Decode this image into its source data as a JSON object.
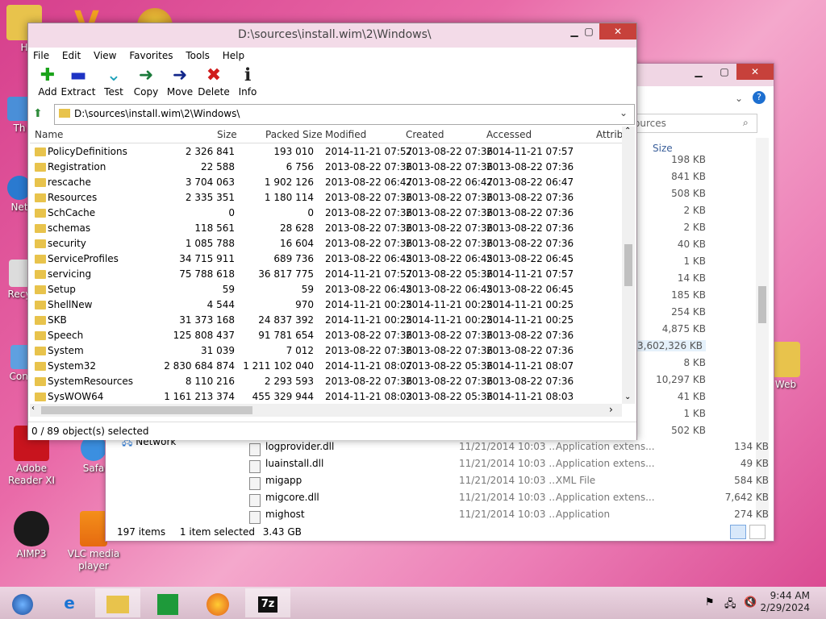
{
  "desktop": {
    "icons": [
      {
        "label": "H",
        "x": 0
      },
      {
        "label": "Th"
      },
      {
        "label": "Net"
      },
      {
        "label": "Recy"
      },
      {
        "label": "Contr"
      },
      {
        "label": "Adobe Reader XI"
      },
      {
        "label": "Safa"
      },
      {
        "label": "AIMP3"
      },
      {
        "label": "VLC media player"
      },
      {
        "label": "Web"
      }
    ]
  },
  "explorer": {
    "search_placeholder": "ources",
    "size_header": "Size",
    "sizes": [
      "198 KB",
      "841 KB",
      "508 KB",
      "2 KB",
      "2 KB",
      "40 KB",
      "1 KB",
      "14 KB",
      "185 KB",
      "254 KB",
      "4,875 KB",
      "3,602,326 KB",
      "8 KB",
      "10,297 KB",
      "41 KB",
      "1 KB",
      "502 KB"
    ],
    "nav_network": "Network",
    "files": [
      {
        "name": "logprovider.dll",
        "date": "11/21/2014 10:03 ...",
        "type": "Application extens...",
        "size": "134 KB"
      },
      {
        "name": "luainstall.dll",
        "date": "11/21/2014 10:03 ...",
        "type": "Application extens...",
        "size": "49 KB"
      },
      {
        "name": "migapp",
        "date": "11/21/2014 10:03 ...",
        "type": "XML File",
        "size": "584 KB"
      },
      {
        "name": "migcore.dll",
        "date": "11/21/2014 10:03 ...",
        "type": "Application extens...",
        "size": "7,642 KB"
      },
      {
        "name": "mighost",
        "date": "11/21/2014 10:03 ...",
        "type": "Application",
        "size": "274 KB"
      }
    ],
    "status_items": "197 items",
    "status_selected": "1 item selected",
    "status_size": "3.43 GB"
  },
  "sevenzip": {
    "title": "D:\\sources\\install.wim\\2\\Windows\\",
    "menu": [
      "File",
      "Edit",
      "View",
      "Favorites",
      "Tools",
      "Help"
    ],
    "toolbar": [
      {
        "label": "Add",
        "glyph": "✚",
        "color": "#1aa31a"
      },
      {
        "label": "Extract",
        "glyph": "▬",
        "color": "#1d33c4"
      },
      {
        "label": "Test",
        "glyph": "⌄",
        "color": "#1aa0b8"
      },
      {
        "label": "Copy",
        "glyph": "➜",
        "color": "#1a7a3a"
      },
      {
        "label": "Move",
        "glyph": "➜",
        "color": "#12268a"
      },
      {
        "label": "Delete",
        "glyph": "✖",
        "color": "#d01c1c"
      },
      {
        "label": "Info",
        "glyph": "ℹ",
        "color": "#222222"
      }
    ],
    "address": "D:\\sources\\install.wim\\2\\Windows\\",
    "columns": [
      "Name",
      "Size",
      "Packed Size",
      "Modified",
      "Created",
      "Accessed",
      "Attrib"
    ],
    "rows": [
      [
        "PolicyDefinitions",
        "2 326 841",
        "193 010",
        "2014-11-21 07:57",
        "2013-08-22 07:36",
        "2014-11-21 07:57"
      ],
      [
        "Registration",
        "22 588",
        "6 756",
        "2013-08-22 07:36",
        "2013-08-22 07:36",
        "2013-08-22 07:36"
      ],
      [
        "rescache",
        "3 704 063",
        "1 902 126",
        "2013-08-22 06:47",
        "2013-08-22 06:47",
        "2013-08-22 06:47"
      ],
      [
        "Resources",
        "2 335 351",
        "1 180 114",
        "2013-08-22 07:36",
        "2013-08-22 07:36",
        "2013-08-22 07:36"
      ],
      [
        "SchCache",
        "0",
        "0",
        "2013-08-22 07:36",
        "2013-08-22 07:36",
        "2013-08-22 07:36"
      ],
      [
        "schemas",
        "118 561",
        "28 628",
        "2013-08-22 07:36",
        "2013-08-22 07:36",
        "2013-08-22 07:36"
      ],
      [
        "security",
        "1 085 788",
        "16 604",
        "2013-08-22 07:36",
        "2013-08-22 07:36",
        "2013-08-22 07:36"
      ],
      [
        "ServiceProfiles",
        "34 715 911",
        "689 736",
        "2013-08-22 06:45",
        "2013-08-22 06:45",
        "2013-08-22 06:45"
      ],
      [
        "servicing",
        "75 788 618",
        "36 817 775",
        "2014-11-21 07:57",
        "2013-08-22 05:36",
        "2014-11-21 07:57"
      ],
      [
        "Setup",
        "59",
        "59",
        "2013-08-22 06:45",
        "2013-08-22 06:45",
        "2013-08-22 06:45"
      ],
      [
        "ShellNew",
        "4 544",
        "970",
        "2014-11-21 00:25",
        "2014-11-21 00:25",
        "2014-11-21 00:25"
      ],
      [
        "SKB",
        "31 373 168",
        "24 837 392",
        "2014-11-21 00:25",
        "2014-11-21 00:25",
        "2014-11-21 00:25"
      ],
      [
        "Speech",
        "125 808 437",
        "91 781 654",
        "2013-08-22 07:36",
        "2013-08-22 07:36",
        "2013-08-22 07:36"
      ],
      [
        "System",
        "31 039",
        "7 012",
        "2013-08-22 07:36",
        "2013-08-22 07:36",
        "2013-08-22 07:36"
      ],
      [
        "System32",
        "2 830 684 874",
        "1 211 102 040",
        "2014-11-21 08:07",
        "2013-08-22 05:36",
        "2014-11-21 08:07"
      ],
      [
        "SystemResources",
        "8 110 216",
        "2 293 593",
        "2013-08-22 07:36",
        "2013-08-22 07:36",
        "2013-08-22 07:36"
      ],
      [
        "SysWOW64",
        "1 161 213 374",
        "455 329 944",
        "2014-11-21 08:03",
        "2013-08-22 05:36",
        "2014-11-21 08:03"
      ]
    ],
    "status": "0 / 89 object(s) selected"
  },
  "taskbar": {
    "time": "9:44 AM",
    "date": "2/29/2024",
    "sevenzip_label": "7z"
  }
}
